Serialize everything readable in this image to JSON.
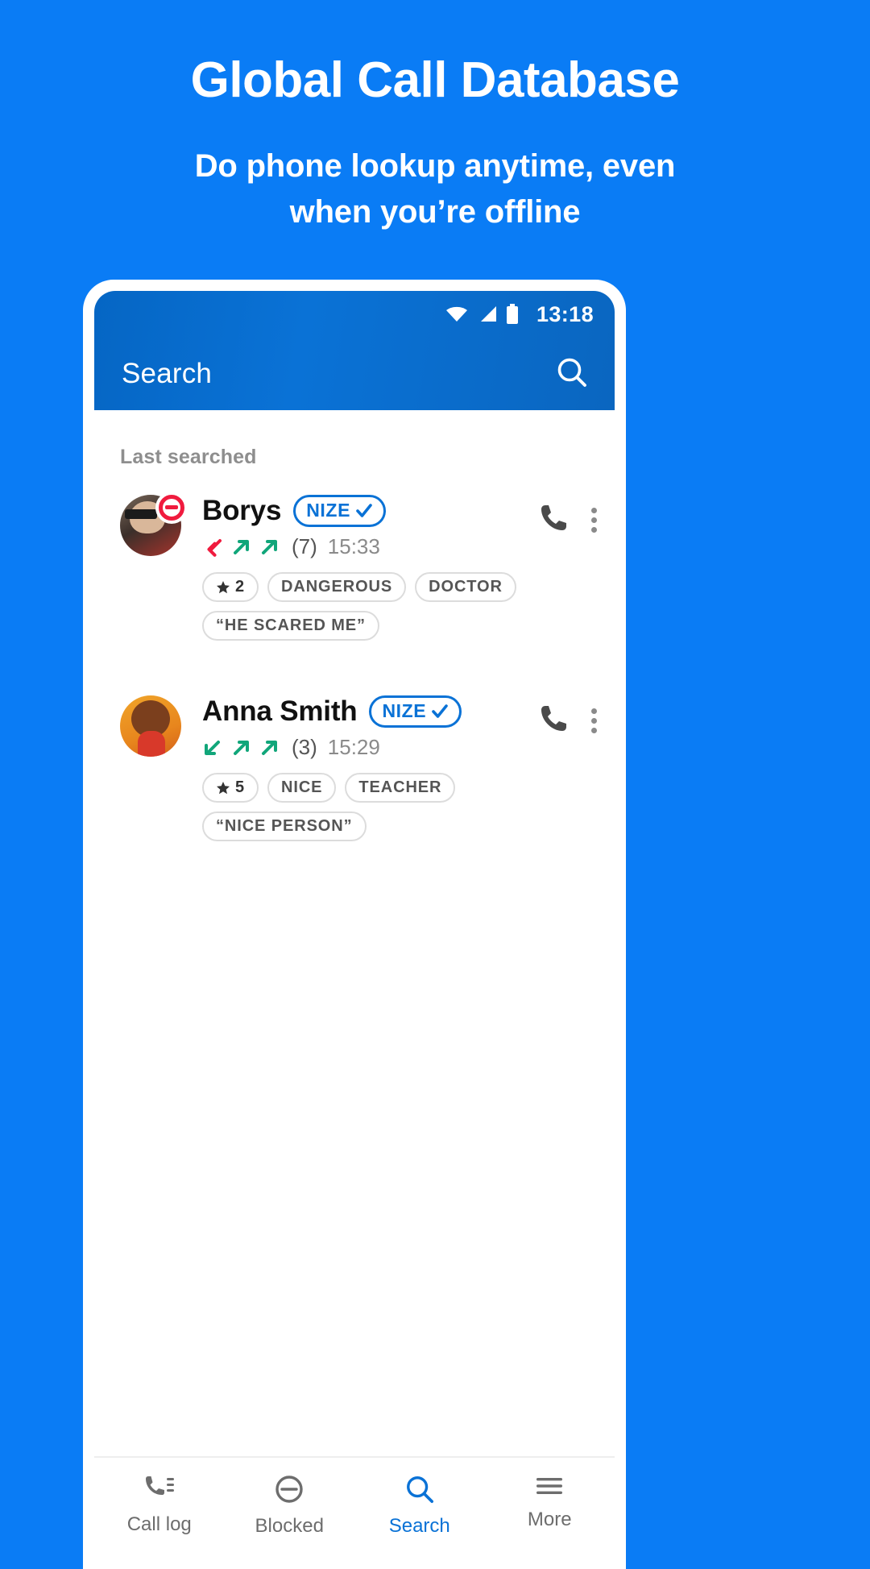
{
  "promo": {
    "title": "Global Call Database",
    "subtitle_line1": "Do phone lookup anytime, even",
    "subtitle_line2": "when you’re offline"
  },
  "colors": {
    "background": "#0a7cf5",
    "appbar": "#0a6cc8",
    "accent": "#0a72d6",
    "blocked_red": "#f01b3e",
    "outgoing_green": "#11a67a",
    "missed_red": "#f01b3e"
  },
  "phone": {
    "statusbar": {
      "time": "13:18",
      "icons": [
        "wifi-icon",
        "signal-icon",
        "battery-icon"
      ]
    },
    "appbar": {
      "title": "Search",
      "search_icon": "search-icon"
    },
    "content": {
      "section_title": "Last searched",
      "contacts": [
        {
          "name": "Borys",
          "verified_badge": "NIZE",
          "blocked": true,
          "avatar": "man-sunglasses-photo",
          "call_arrows": [
            "missed-in",
            "out",
            "out"
          ],
          "call_count": "(7)",
          "time": "15:33",
          "rating": "2",
          "tags": [
            "DANGEROUS",
            "DOCTOR"
          ],
          "quote": "“HE SCARED ME”",
          "call_icon": "phone-icon",
          "menu_icon": "more-vertical-icon"
        },
        {
          "name": "Anna Smith",
          "verified_badge": "NIZE",
          "blocked": false,
          "avatar": "woman-red-top-photo",
          "call_arrows": [
            "in",
            "out",
            "out"
          ],
          "call_count": "(3)",
          "time": "15:29",
          "rating": "5",
          "tags": [
            "NICE",
            "TEACHER"
          ],
          "quote": "“NICE PERSON”",
          "call_icon": "phone-icon",
          "menu_icon": "more-vertical-icon"
        }
      ]
    },
    "bottom_nav": [
      {
        "label": "Call log",
        "icon": "call-log-icon",
        "active": false
      },
      {
        "label": "Blocked",
        "icon": "blocked-icon",
        "active": false
      },
      {
        "label": "Search",
        "icon": "search-icon",
        "active": true
      },
      {
        "label": "More",
        "icon": "menu-icon",
        "active": false
      }
    ]
  }
}
